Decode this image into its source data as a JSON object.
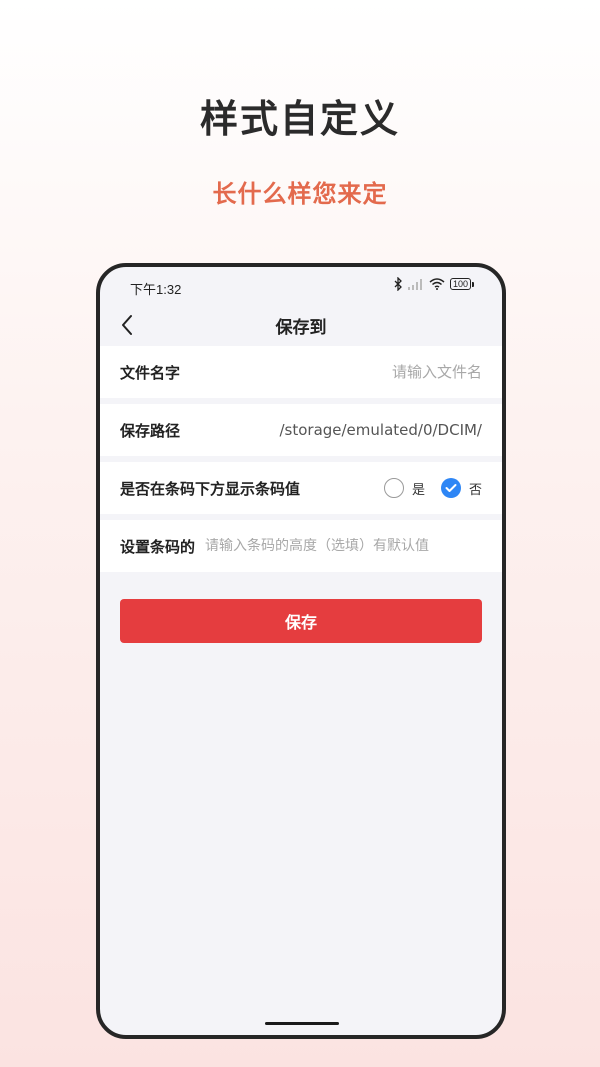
{
  "promo": {
    "headline": "样式自定义",
    "subline": "长什么样您来定"
  },
  "statusbar": {
    "time": "下午1:32",
    "battery": "100",
    "icons": [
      "bluetooth-icon",
      "signal-icon",
      "wifi-icon",
      "battery-icon"
    ]
  },
  "nav": {
    "back_icon": "chevron-left-icon",
    "title": "保存到"
  },
  "form": {
    "file_name": {
      "label": "文件名字",
      "value": "",
      "placeholder": "请输入文件名"
    },
    "save_path": {
      "label": "保存路径",
      "value": "/storage/emulated/0/DCIM/"
    },
    "show_value": {
      "label": "是否在条码下方显示条码值",
      "options": [
        {
          "label": "是",
          "checked": false
        },
        {
          "label": "否",
          "checked": true
        }
      ]
    },
    "barcode_height": {
      "label": "设置条码的",
      "value": "",
      "placeholder": "请输入条码的高度（选填）有默认值"
    }
  },
  "actions": {
    "save_label": "保存"
  },
  "colors": {
    "accent_red": "#e53d3f",
    "subline_orange": "#e36a4d",
    "radio_blue": "#2e86f5",
    "page_bg": "#f4f4f8"
  }
}
